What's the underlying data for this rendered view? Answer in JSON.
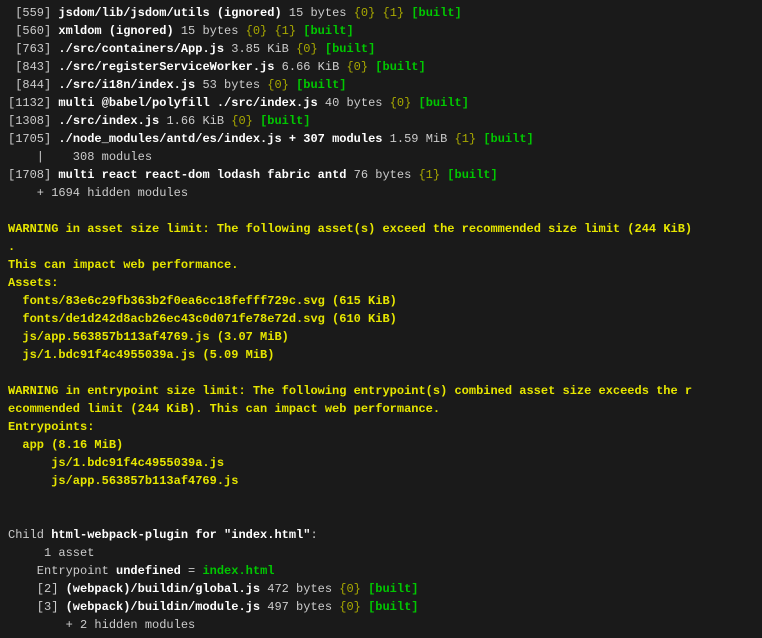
{
  "modules": [
    {
      "id": "[559]",
      "name": "jsdom/lib/jsdom/utils (ignored)",
      "size": "15 bytes",
      "chunks": "{0}",
      "extra": " {1}",
      "built": "[built]",
      "indent": " "
    },
    {
      "id": "[560]",
      "name": "xmldom (ignored)",
      "size": "15 bytes",
      "chunks": "{0}",
      "extra": " {1}",
      "built": "[built]",
      "indent": " "
    },
    {
      "id": "[763]",
      "name": "./src/containers/App.js",
      "size": "3.85 KiB",
      "chunks": "{0}",
      "extra": "",
      "built": "[built]",
      "indent": " "
    },
    {
      "id": "[843]",
      "name": "./src/registerServiceWorker.js",
      "size": "6.66 KiB",
      "chunks": "{0}",
      "extra": "",
      "built": "[built]",
      "indent": " "
    },
    {
      "id": "[844]",
      "name": "./src/i18n/index.js",
      "size": "53 bytes",
      "chunks": "{0}",
      "extra": "",
      "built": "[built]",
      "indent": " "
    },
    {
      "id": "[1132]",
      "name": "multi @babel/polyfill ./src/index.js",
      "size": "40 bytes",
      "chunks": "{0}",
      "extra": "",
      "built": "[built]",
      "indent": ""
    },
    {
      "id": "[1308]",
      "name": "./src/index.js",
      "size": "1.66 KiB",
      "chunks": "{0}",
      "extra": "",
      "built": "[built]",
      "indent": ""
    },
    {
      "id": "[1705]",
      "name": "./node_modules/antd/es/index.js + 307 modules",
      "size": "1.59 MiB",
      "chunks": "{1}",
      "extra": "",
      "built": "[built]",
      "indent": ""
    }
  ],
  "submod": "    |    308 modules",
  "module_last": {
    "id": "[1708]",
    "name": "multi react react-dom lodash fabric antd",
    "size": "76 bytes",
    "chunks": "{1}",
    "built": "[built]"
  },
  "hidden_main": "    + 1694 hidden modules",
  "blank": "",
  "warning1": {
    "prefix": "WARNING in ",
    "title": "asset size limit: The following asset(s) exceed the recommended size limit (244 KiB)",
    "cont": ".",
    "line2": "This can impact web performance.",
    "line3": "Assets:",
    "assets": [
      "  fonts/83e6c29fb363b2f0ea6cc18fefff729c.svg (615 KiB)",
      "  fonts/de1d242d8acb26ec43c0d071fe78e72d.svg (610 KiB)",
      "  js/app.563857b113af4769.js (3.07 MiB)",
      "  js/1.bdc91f4c4955039a.js (5.09 MiB)"
    ]
  },
  "warning2": {
    "prefix": "WARNING in ",
    "title": "entrypoint size limit: The following entrypoint(s) combined asset size exceeds the r",
    "cont": "ecommended limit (244 KiB). This can impact web performance.",
    "line2": "Entrypoints:",
    "l3": "  app (8.16 MiB)",
    "l4": "      js/1.bdc91f4c4955039a.js",
    "l5": "      js/app.563857b113af4769.js",
    "l6": " "
  },
  "child": {
    "prefix": "Child ",
    "name": "html-webpack-plugin for \"index.html\"",
    "suffix": ":",
    "asset": "     1 asset",
    "entry_prefix": "    Entrypoint ",
    "entry_undef": "undefined",
    "entry_eq": " = ",
    "entry_file": "index.html",
    "mods": [
      {
        "indent": "    ",
        "id": "[2]",
        "name": "(webpack)/buildin/global.js",
        "size": "472 bytes",
        "chunks": "{0}",
        "built": "[built]"
      },
      {
        "indent": "    ",
        "id": "[3]",
        "name": "(webpack)/buildin/module.js",
        "size": "497 bytes",
        "chunks": "{0}",
        "built": "[built]"
      }
    ],
    "hidden": "        + 2 hidden modules"
  }
}
